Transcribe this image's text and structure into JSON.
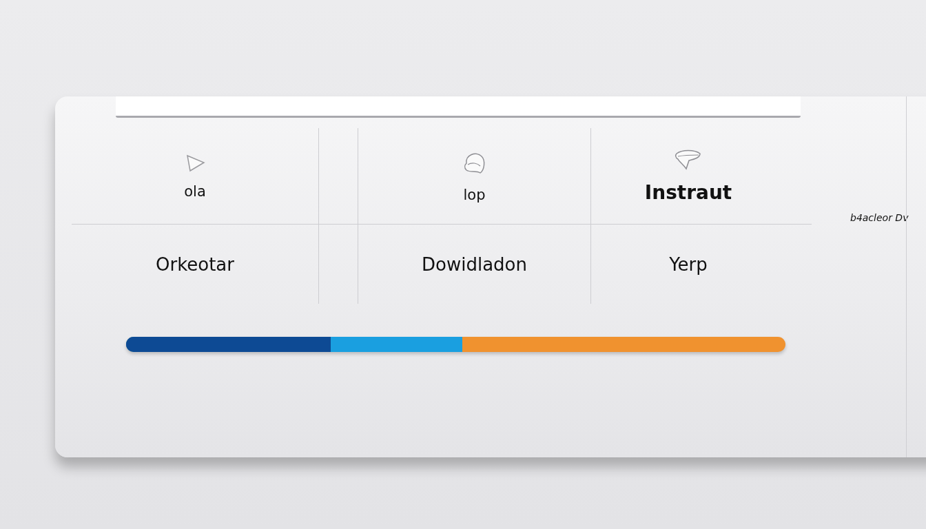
{
  "tiles": [
    {
      "kind": "arrow",
      "label": "ola",
      "selected": false
    },
    {
      "kind": "blob",
      "label": "lop",
      "selected": false
    },
    {
      "kind": "ribbon",
      "label": "Instraut",
      "selected": true
    }
  ],
  "actions": [
    "Orkeotar",
    "Dowidladon",
    "Yerp"
  ],
  "side_label": "b4acleor Dv",
  "progress": {
    "color": "#f0922f",
    "segments": [
      {
        "level": 0.31,
        "color": "#0d4a94"
      },
      {
        "level": 0.51,
        "color": "#1a9fe0"
      }
    ]
  }
}
